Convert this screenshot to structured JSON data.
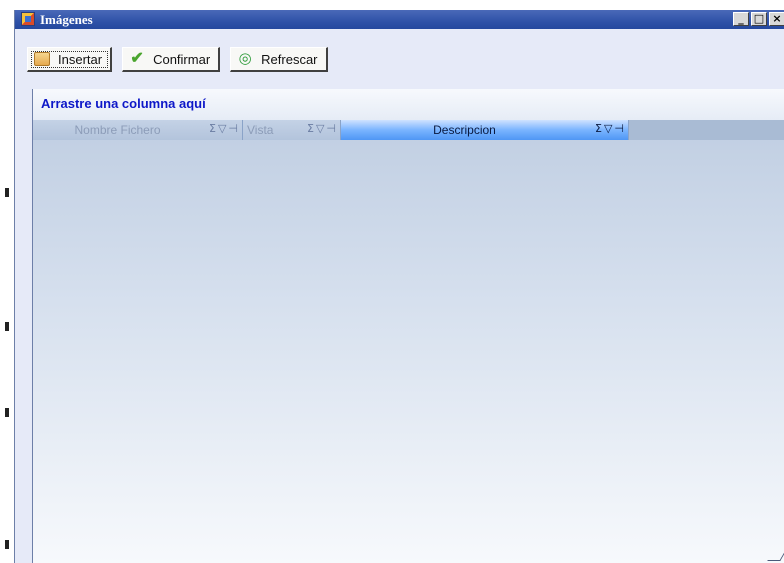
{
  "window": {
    "title": "Imágenes",
    "controls": {
      "minimize": "_",
      "maximize": "□",
      "close": "×"
    }
  },
  "toolbar": {
    "insert_label": "Insertar",
    "confirm_label": "Confirmar",
    "refresh_label": "Refrescar"
  },
  "grid": {
    "group_prompt": "Arrastre una columna aquí",
    "columns": [
      {
        "label": "Nombre Fichero"
      },
      {
        "label": "Vista"
      },
      {
        "label": "Descripcion"
      }
    ],
    "header_glyphs": {
      "sum": "Σ",
      "filter": "▽",
      "pin": "⊣"
    }
  },
  "icons": {
    "insert": "insert-image-icon",
    "confirm": "checkmark-icon",
    "refresh": "refresh-icon",
    "app": "window-app-icon"
  },
  "colors": {
    "titlebar": "#2f52a8",
    "group_text": "#0d17c8",
    "active_header": "#4f96f5"
  }
}
